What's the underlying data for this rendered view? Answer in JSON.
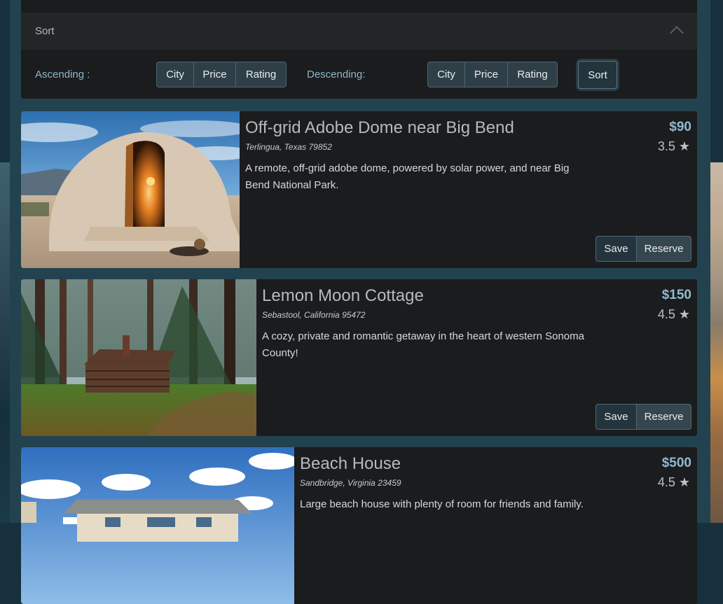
{
  "sort_panel": {
    "title": "Sort",
    "ascending_label": "Ascending :",
    "descending_label": "Descending:",
    "ascending_buttons": [
      "City",
      "Price",
      "Rating"
    ],
    "descending_buttons": [
      "City",
      "Price",
      "Rating"
    ],
    "sort_button": "Sort"
  },
  "listings": [
    {
      "title": "Off-grid Adobe Dome near Big Bend",
      "location": "Terlingua, Texas 79852",
      "description": "A remote, off-grid adobe dome, powered by solar power, and near Big Bend National Park.",
      "price": "$90",
      "rating": "3.5 ★"
    },
    {
      "title": "Lemon Moon Cottage",
      "location": "Sebastool, California 95472",
      "description": "A cozy, private and romantic getaway in the heart of western Sonoma County!",
      "price": "$150",
      "rating": "4.5 ★"
    },
    {
      "title": "Beach House",
      "location": "Sandbridge, Virginia 23459",
      "description": "Large beach house with plenty of room for friends and family.",
      "price": "$500",
      "rating": "4.5 ★"
    }
  ],
  "actions": {
    "save": "Save",
    "reserve": "Reserve"
  }
}
